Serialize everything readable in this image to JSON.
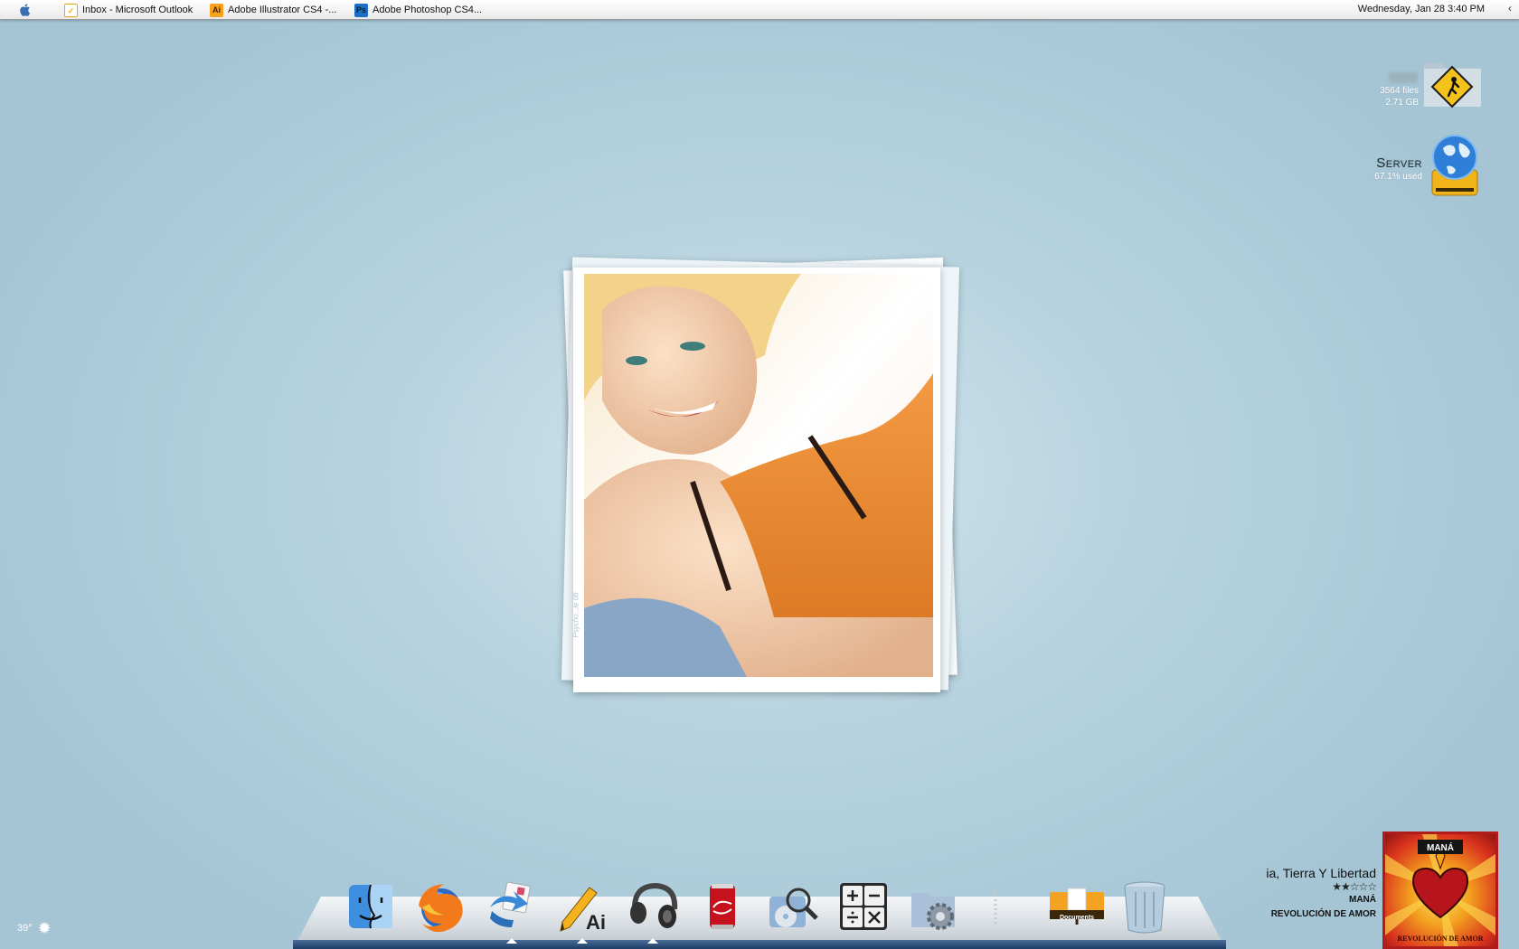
{
  "menubar": {
    "apple_icon": "apple-logo-icon",
    "tasks": [
      {
        "label": "Inbox - Microsoft Outlook",
        "icon": "outlook-icon",
        "icon_color": "#f0a41d"
      },
      {
        "label": "Adobe Illustrator CS4 -...",
        "icon": "illustrator-icon",
        "icon_text": "Ai",
        "icon_color": "#f7a21b"
      },
      {
        "label": "Adobe Photoshop CS4...",
        "icon": "photoshop-icon",
        "icon_text": "Ps",
        "icon_color": "#1f6fc1"
      }
    ],
    "clock": "Wednesday, Jan 28  3:40 PM",
    "collapse_arrow": "‹"
  },
  "desktop": {
    "drive1": {
      "files": "3564 files",
      "size": "2.71 GB",
      "icon": "public-folder-icon"
    },
    "server": {
      "name": "Server",
      "usage": "67.1% used",
      "icon": "network-drive-icon"
    }
  },
  "dock": {
    "items": [
      {
        "name": "finder",
        "icon": "finder-icon"
      },
      {
        "name": "firefox",
        "icon": "firefox-icon"
      },
      {
        "name": "mail",
        "icon": "mail-icon"
      },
      {
        "name": "illustrator",
        "icon": "illustrator-pencil-icon"
      },
      {
        "name": "headphones",
        "icon": "headphones-icon"
      },
      {
        "name": "coca-cola",
        "icon": "coca-cola-can-icon"
      },
      {
        "name": "disk-utility",
        "icon": "disk-search-icon"
      },
      {
        "name": "calculator",
        "icon": "calculator-icon"
      },
      {
        "name": "system-preferences",
        "icon": "system-preferences-icon"
      },
      {
        "name": "separator",
        "icon": "dock-separator-icon"
      },
      {
        "name": "documents",
        "icon": "documents-stack-icon",
        "label": "Documents"
      },
      {
        "name": "trash",
        "icon": "trash-icon"
      }
    ]
  },
  "now_playing": {
    "song": "ia, Tierra Y Libertad",
    "rating": 2,
    "rating_max": 5,
    "artist": "MANÁ",
    "album": "REVOLUCIÓN DE AMOR",
    "album_art_text_top": "MANÁ",
    "album_art_text_bottom": "REVOLUCIÓN DE AMOR"
  },
  "weather": {
    "temperature": "39°",
    "icon": "sun-icon"
  },
  "wallpaper": {
    "signature": "Psycho...le 08"
  }
}
